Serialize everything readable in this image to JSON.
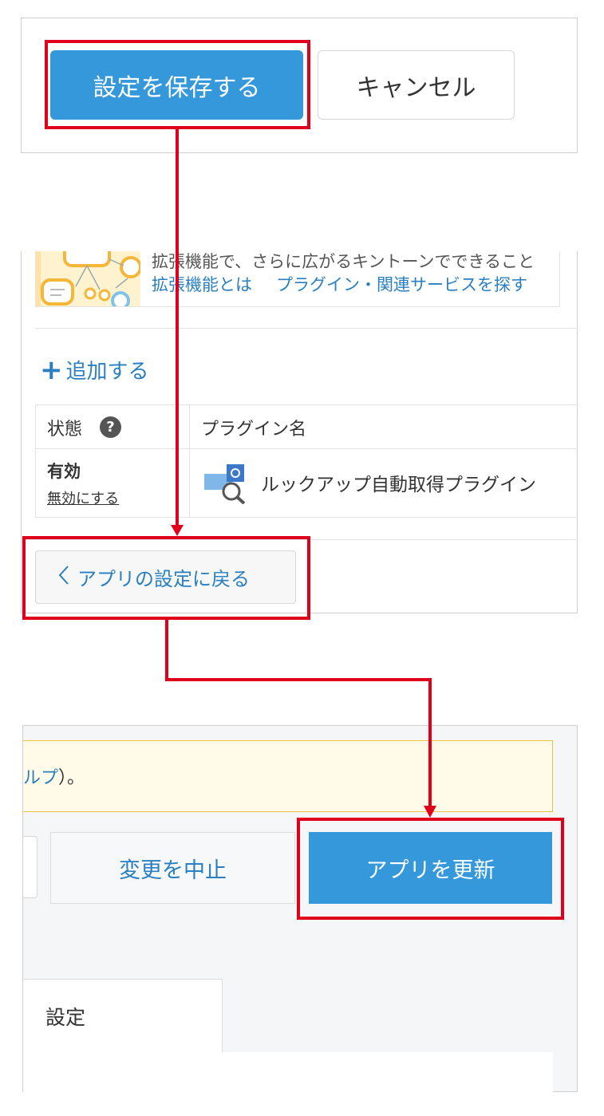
{
  "panel1": {
    "save_label": "設定を保存する",
    "cancel_label": "キャンセル"
  },
  "panel2": {
    "banner_text_cut": "拡張機能で、さらに広がるキントーンでできること",
    "banner_link1": "拡張機能とは",
    "banner_link2": "プラグイン・関連サービスを探す",
    "add_label": "追加する",
    "table": {
      "header_status": "状態",
      "header_name": "プラグイン名",
      "row_status": "有効",
      "row_disable": "無効にする",
      "row_plugin_name": "ルックアップ自動取得プラグイン"
    },
    "back_label": "アプリの設定に戻る"
  },
  "panel3": {
    "notice_link": "ルプ",
    "notice_tail": "）。",
    "cancel_change_label": "変更を中止",
    "update_label": "アプリを更新",
    "tab_settings": "設定"
  },
  "colors": {
    "primary_blue": "#3498db",
    "link_blue": "#2a7fc0",
    "highlight_red": "#e0001b"
  }
}
